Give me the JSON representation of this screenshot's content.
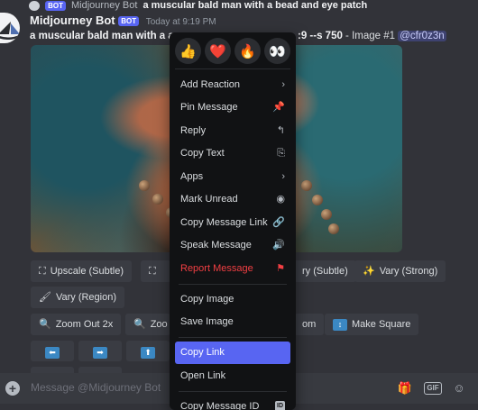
{
  "reply": {
    "bot_badge": "BOT",
    "author": "Midjourney Bot",
    "text": "a muscular bald man with a bead and eye patch"
  },
  "message": {
    "author": "Midjourney Bot",
    "bot_badge": "BOT",
    "timestamp": "Today at 9:19 PM",
    "prompt_bold": "a muscular bald man with a a",
    "params_bold": ":9 --s 750",
    "suffix": " - Image #1 ",
    "mention": "@cfr0z3n"
  },
  "buttons": {
    "upscale_subtle": "Upscale (Subtle)",
    "vary_subtle": "ry (Subtle)",
    "vary_strong": "Vary (Strong)",
    "vary_region": "Vary (Region)",
    "zoom_out_2x": "Zoom Out 2x",
    "zoom_custom": "Zoo",
    "zoom_tail": "om",
    "make_square": "Make Square"
  },
  "context_menu": {
    "reactions": [
      "👍",
      "❤️",
      "🔥",
      "👀"
    ],
    "items": [
      {
        "label": "Add Reaction",
        "icon": "›"
      },
      {
        "label": "Pin Message",
        "icon": "📌"
      },
      {
        "label": "Reply",
        "icon": "↰"
      },
      {
        "label": "Copy Text",
        "icon": "⎘"
      },
      {
        "label": "Apps",
        "icon": "›"
      },
      {
        "label": "Mark Unread",
        "icon": "◉"
      },
      {
        "label": "Copy Message Link",
        "icon": "🔗"
      },
      {
        "label": "Speak Message",
        "icon": "🔊"
      },
      {
        "label": "Report Message",
        "icon": "⚑"
      },
      {
        "label": "Copy Image",
        "icon": ""
      },
      {
        "label": "Save Image",
        "icon": ""
      },
      {
        "label": "Copy Link",
        "icon": ""
      },
      {
        "label": "Open Link",
        "icon": ""
      },
      {
        "label": "Copy Message ID",
        "icon": "ID"
      }
    ]
  },
  "input": {
    "placeholder": "Message @Midjourney Bot",
    "gif_label": "GIF"
  },
  "colors": {
    "background": "#323339",
    "menu": "#111214",
    "accent": "#5865f2",
    "danger": "#f23f43"
  }
}
